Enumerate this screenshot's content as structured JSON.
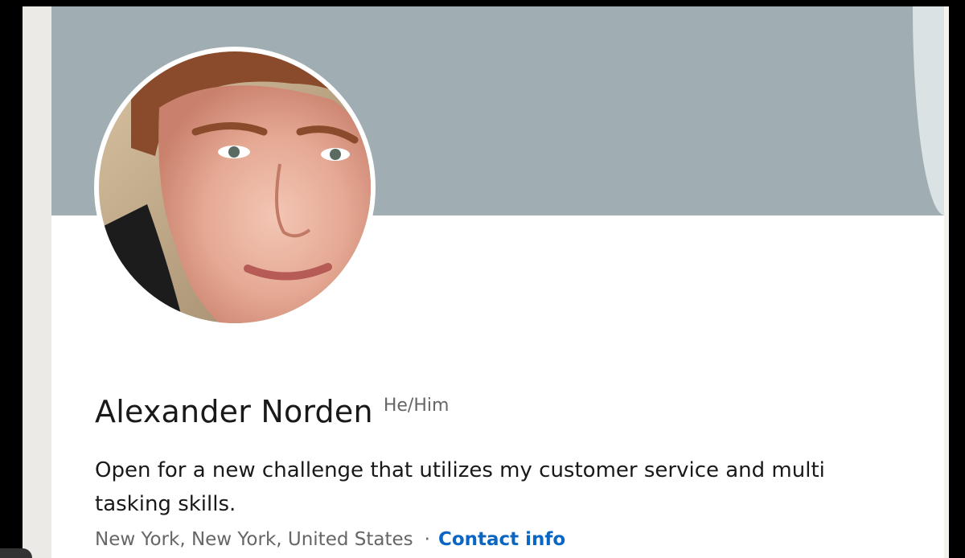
{
  "profile": {
    "name": "Alexander Norden",
    "pronouns": "He/Him",
    "headline": "Open for a new challenge that utilizes my customer service and multi tasking skills.",
    "location": "New York, New York, United States",
    "separator": "·",
    "contact_label": "Contact info"
  },
  "colors": {
    "cover": "#a0aeb3",
    "link": "#0a66c2",
    "text": "#191919",
    "muted": "#666666"
  }
}
